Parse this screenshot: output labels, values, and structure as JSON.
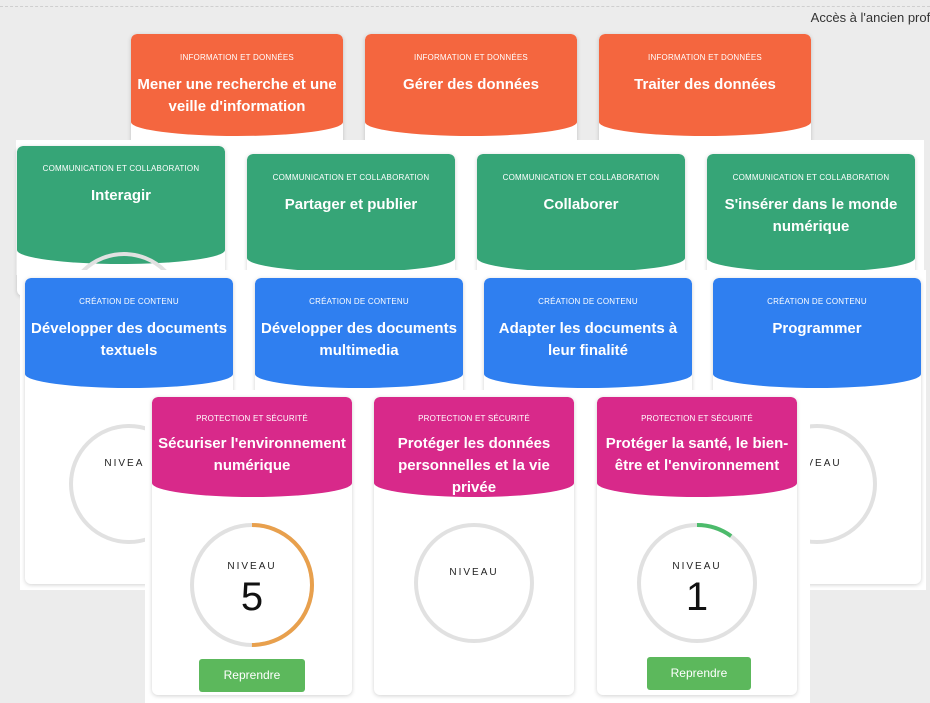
{
  "header": {
    "old_profile_link": "Accès à l'ancien profil"
  },
  "colors": {
    "orange": "#f4663f",
    "green": "#36a577",
    "blue": "#2f7ff0",
    "pink": "#d8298a",
    "level_orange": "#e8a04d",
    "level_green": "#4cbb6b",
    "button": "#5cb85c"
  },
  "rows": {
    "information": {
      "category": "INFORMATION ET DONNÉES",
      "cards": [
        {
          "title": "Mener une recherche et une veille d'information"
        },
        {
          "title": "Gérer des données"
        },
        {
          "title": "Traiter des données"
        }
      ]
    },
    "communication": {
      "category": "COMMUNICATION ET COLLABORATION",
      "cards": [
        {
          "title": "Interagir"
        },
        {
          "title": "Partager et publier"
        },
        {
          "title": "Collaborer"
        },
        {
          "title": "S'insérer dans le monde numérique"
        }
      ]
    },
    "creation": {
      "category": "CRÉATION DE CONTENU",
      "cards": [
        {
          "title": "Développer des documents textuels",
          "level_label": "NIVEAU"
        },
        {
          "title": "Développer des documents multimedia"
        },
        {
          "title": "Adapter les documents à leur finalité"
        },
        {
          "title": "Programmer",
          "level_label": "NIVEAU"
        }
      ]
    },
    "protection": {
      "category": "PROTECTION ET SÉCURITÉ",
      "cards": [
        {
          "title": "Sécuriser l'environnement numérique",
          "level_label": "NIVEAU",
          "level": "5",
          "progress": 0.5,
          "button": "Reprendre"
        },
        {
          "title": "Protéger les données personnelles et la vie privée",
          "level_label": "NIVEAU"
        },
        {
          "title": "Protéger la santé, le bien-être et l'environnement",
          "level_label": "NIVEAU",
          "level": "1",
          "progress": 0.1,
          "button": "Reprendre"
        }
      ]
    }
  }
}
